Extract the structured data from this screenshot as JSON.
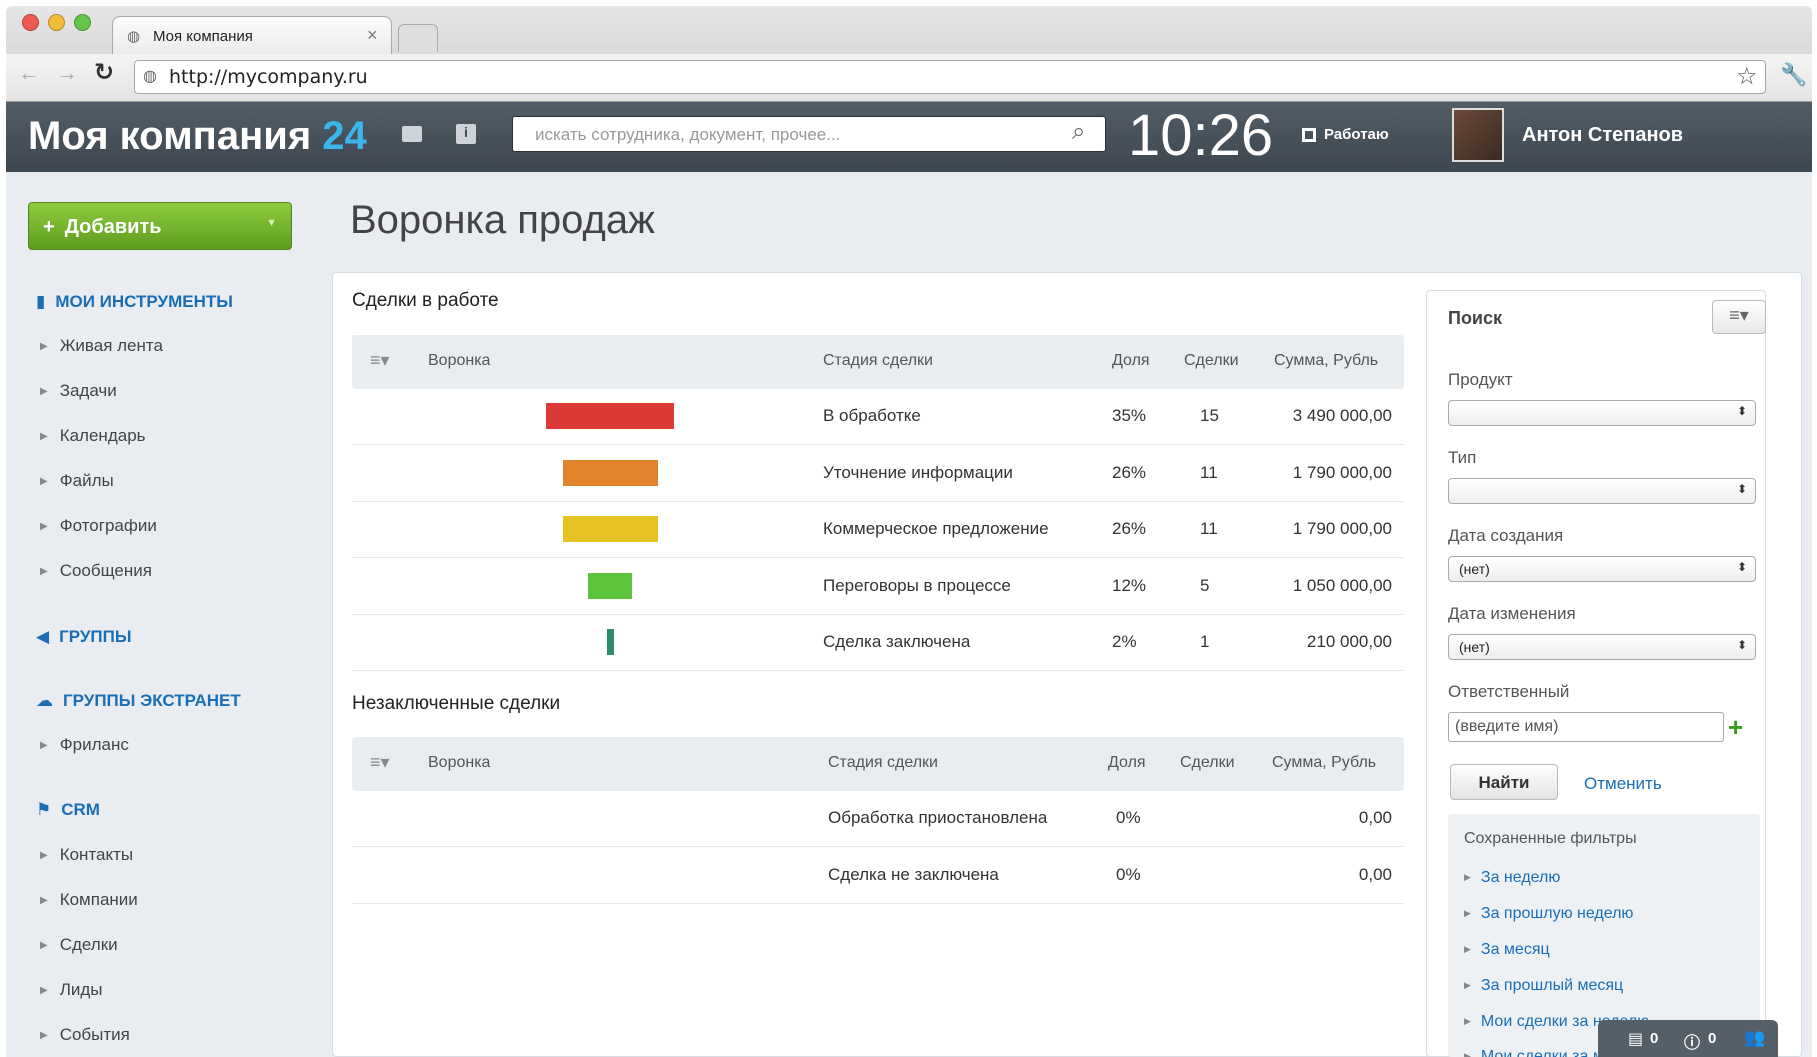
{
  "browser": {
    "tab_title": "Моя компания",
    "tab_close": "×",
    "url": "http://mycompany.ru"
  },
  "header": {
    "logo_text": "Моя компания",
    "logo_number": "24",
    "search_placeholder": "искать сотрудника, документ, прочее...",
    "clock": "10:26",
    "status_label": "Работаю",
    "user_name": "Антон Степанов"
  },
  "sidebar": {
    "add_button": "Добавить",
    "sections": [
      {
        "title": "МОИ ИНСТРУМЕНТЫ",
        "items": [
          "Живая лента",
          "Задачи",
          "Календарь",
          "Файлы",
          "Фотографии",
          "Сообщения"
        ]
      },
      {
        "title": "ГРУППЫ",
        "items": []
      },
      {
        "title": "ГРУППЫ ЭКСТРАНЕТ",
        "items": [
          "Фриланс"
        ]
      },
      {
        "title": "CRM",
        "items": [
          "Контакты",
          "Компании",
          "Сделки",
          "Лиды",
          "События"
        ]
      }
    ]
  },
  "main": {
    "page_title": "Воронка продаж",
    "active_title": "Сделки в работе",
    "closed_title": "Незаключенные сделки",
    "columns": [
      "Воронка",
      "Стадия сделки",
      "Доля",
      "Сделки",
      "Сумма, Рубль"
    ],
    "active_rows": [
      {
        "stage": "В обработке",
        "share": "35%",
        "deals": "15",
        "sum": "3 490 000,00",
        "share_value": 35,
        "color": "#d93a36"
      },
      {
        "stage": "Уточнение информации",
        "share": "26%",
        "deals": "11",
        "sum": "1 790 000,00",
        "share_value": 26,
        "color": "#e0832a"
      },
      {
        "stage": "Коммерческое предложение",
        "share": "26%",
        "deals": "11",
        "sum": "1 790 000,00",
        "share_value": 26,
        "color": "#e6c322"
      },
      {
        "stage": "Переговоры в процессе",
        "share": "12%",
        "deals": "5",
        "sum": "1 050 000,00",
        "share_value": 12,
        "color": "#5cc43c"
      },
      {
        "stage": "Сделка заключена",
        "share": "2%",
        "deals": "1",
        "sum": "210 000,00",
        "share_value": 2,
        "color": "#2e8a6a"
      }
    ],
    "closed_rows": [
      {
        "stage": "Обработка приостановлена",
        "share": "0%",
        "deals": "",
        "sum": "0,00"
      },
      {
        "stage": "Сделка не заключена",
        "share": "0%",
        "deals": "",
        "sum": "0,00"
      }
    ]
  },
  "filter": {
    "title": "Поиск",
    "fields": [
      {
        "label": "Продукт",
        "value": ""
      },
      {
        "label": "Тип",
        "value": ""
      },
      {
        "label": "Дата создания",
        "value": "(нет)"
      },
      {
        "label": "Дата изменения",
        "value": "(нет)"
      }
    ],
    "responsible_label": "Ответственный",
    "responsible_placeholder": "(введите имя)",
    "find_button": "Найти",
    "cancel_link": "Отменить",
    "saved_title": "Сохраненные фильтры",
    "saved": [
      "За неделю",
      "За прошлую неделю",
      "За месяц",
      "За прошлый месяц",
      "Мои сделки за неделю",
      "Мои сделки за месяц"
    ]
  },
  "bottom_bar": {
    "messages": "0",
    "notifications": "0"
  }
}
